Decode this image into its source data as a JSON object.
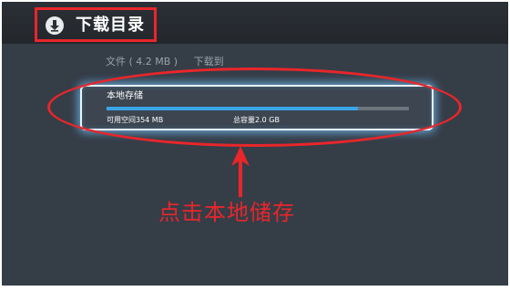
{
  "header": {
    "title": "下载目录",
    "download_icon": "download-icon"
  },
  "subtitle": {
    "file_info": "文件 ( 4.2 MB )",
    "download_to": "下载到"
  },
  "storage": {
    "title": "本地存储",
    "free_space": "可用空间354 MB",
    "total_capacity": "总容量2.0 GB",
    "used_fraction": 0.83
  },
  "annotation": {
    "instruction": "点击本地储存",
    "color": "#e8262b"
  },
  "colors": {
    "background": "#353d47",
    "progress": "#3aa6e8",
    "glow": "#78c8ff"
  }
}
